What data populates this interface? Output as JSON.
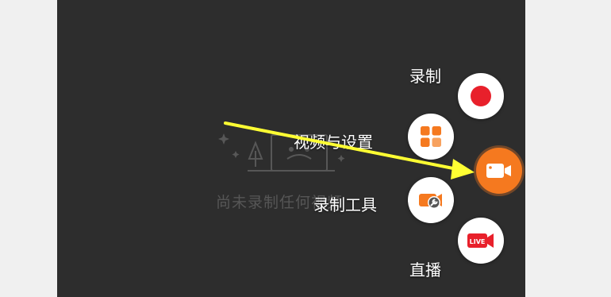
{
  "empty_state": {
    "text": "尚未录制任何视频"
  },
  "menu": {
    "record_label": "录制",
    "video_settings_label": "视频与设置",
    "record_tools_label": "录制工具",
    "live_label": "直播",
    "live_badge": "LIVE"
  },
  "icons": {
    "record": "record-dot-icon",
    "settings": "grid-icon",
    "tools": "camera-wrench-icon",
    "live": "live-camera-icon",
    "main": "video-camera-icon"
  },
  "colors": {
    "accent": "#f5791f",
    "record_red": "#e8202b",
    "annotation_arrow": "#ffff33",
    "background": "#2d2d2d"
  }
}
